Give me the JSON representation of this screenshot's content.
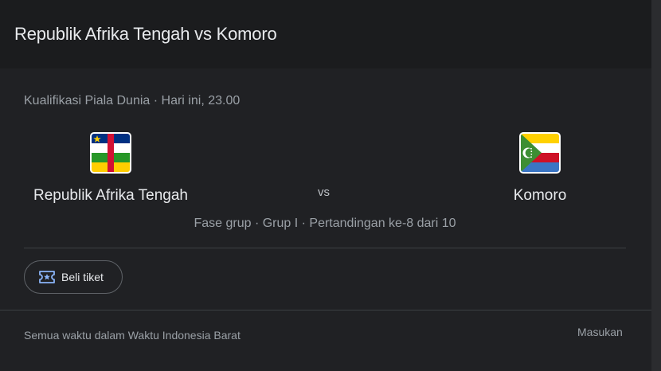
{
  "header": {
    "title": "Republik Afrika Tengah vs Komoro"
  },
  "match": {
    "competition_time": "Kualifikasi Piala Dunia · Hari ini, 23.00",
    "home_team": "Republik Afrika Tengah",
    "away_team": "Komoro",
    "vs_label": "vs",
    "stage": "Fase grup · Grup I · Pertandingan ke-8 dari 10"
  },
  "actions": {
    "ticket_label": "Beli tiket",
    "ticket_icon": "ticket-icon"
  },
  "footer": {
    "timezone_note": "Semua waktu dalam Waktu Indonesia Barat",
    "feedback_label": "Masukan"
  },
  "colors": {
    "background": "#202124",
    "header_background": "#1b1c1e",
    "text_primary": "#e8eaed",
    "text_secondary": "#9aa0a6",
    "divider": "#3c4043"
  }
}
